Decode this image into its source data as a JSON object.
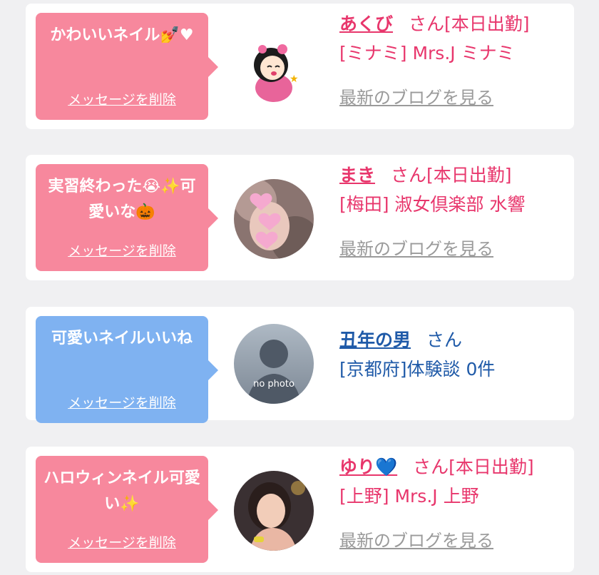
{
  "messages": [
    {
      "bubble_text": "かわいいネイル",
      "bubble_emoji": "💅♥",
      "delete_label": "メッセージを削除",
      "name": "あくび",
      "suffix": "さん[本日出勤]",
      "shop_line": "[ミナミ] Mrs.J ミナミ",
      "blog_label": "最新のブログを見る",
      "theme": "pink",
      "avatar_icon": "cartoon-girl-sticker"
    },
    {
      "bubble_text": "実習終わった😭✨可愛いな",
      "bubble_emoji": "🎃",
      "delete_label": "メッセージを削除",
      "name": "まき",
      "suffix": "さん[本日出勤]",
      "shop_line": "[梅田] 淑女倶楽部 水響",
      "blog_label": "最新のブログを見る",
      "theme": "pink",
      "avatar_icon": "profile-photo-heart-masked"
    },
    {
      "bubble_text": "可愛いネイルいいね",
      "bubble_emoji": "",
      "delete_label": "メッセージを削除",
      "name": "丑年の男",
      "suffix": "さん",
      "shop_line": "[京都府]体験談 0件",
      "theme": "blue",
      "avatar_icon": "no-photo-silhouette",
      "avatar_caption": "no photo"
    },
    {
      "bubble_text": "ハロウィンネイル可愛い",
      "bubble_emoji": "✨",
      "delete_label": "メッセージを削除",
      "name": "ゆり💙",
      "suffix": "さん[本日出勤]",
      "shop_line": "[上野] Mrs.J 上野",
      "blog_label": "最新のブログを見る",
      "theme": "pink",
      "avatar_icon": "profile-photo-woman"
    }
  ],
  "colors": {
    "pink_bubble": "#f7889d",
    "blue_bubble": "#7fb2f1",
    "pink_text": "#e8366c",
    "blue_text": "#1f5aa8",
    "link_gray": "#9a9a9a",
    "background": "#f0f0f2"
  }
}
